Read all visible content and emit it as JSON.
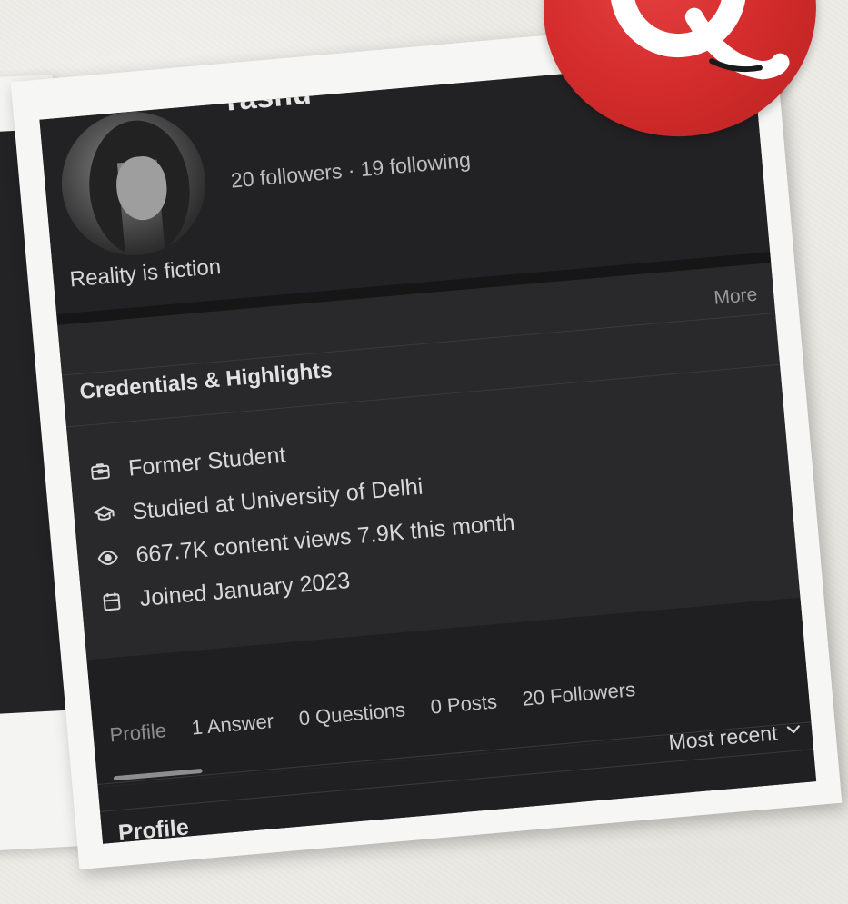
{
  "profile": {
    "name": "Yashu",
    "follow_stats": "20 followers · 19 following",
    "bio": "Reality is fiction"
  },
  "credentials": {
    "more_label": "More",
    "title": "Credentials & Highlights",
    "items": [
      {
        "icon": "briefcase-icon",
        "text": "Former Student"
      },
      {
        "icon": "graduation-cap-icon",
        "text": "Studied at University of Delhi"
      },
      {
        "icon": "eye-icon",
        "text": "667.7K content views 7.9K this month"
      },
      {
        "icon": "calendar-icon",
        "text": "Joined January 2023"
      }
    ]
  },
  "tabs": [
    {
      "label": "Profile",
      "active": true
    },
    {
      "label": "1 Answer"
    },
    {
      "label": "0 Questions"
    },
    {
      "label": "0 Posts"
    },
    {
      "label": "20 Followers"
    }
  ],
  "sort": {
    "label": "Most recent"
  },
  "section": {
    "heading": "Profile"
  },
  "brand": {
    "icon": "quora-logo-icon",
    "accent": "#d42c2c"
  }
}
